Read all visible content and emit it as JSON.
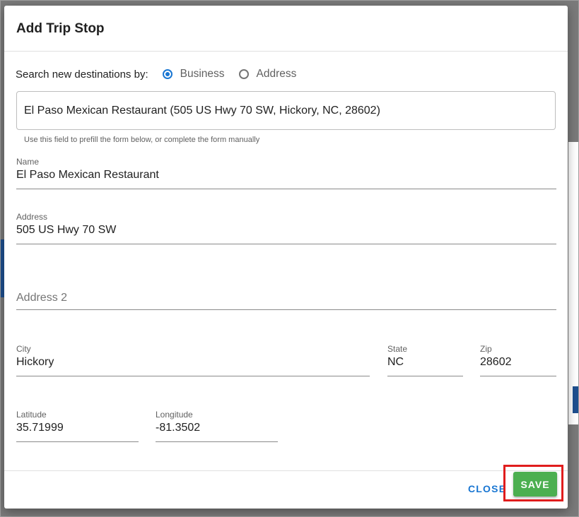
{
  "dialog": {
    "title": "Add Trip Stop",
    "search": {
      "label": "Search new destinations by:",
      "options": [
        {
          "label": "Business",
          "selected": true
        },
        {
          "label": "Address",
          "selected": false
        }
      ],
      "value": "El Paso Mexican Restaurant  (505 US Hwy 70 SW, Hickory, NC, 28602)",
      "hint": "Use this field to prefill the form below, or complete the form manually"
    },
    "fields": {
      "name": {
        "label": "Name",
        "value": "El Paso Mexican Restaurant"
      },
      "address": {
        "label": "Address",
        "value": "505 US Hwy 70 SW"
      },
      "address2": {
        "label": "Address 2",
        "value": ""
      },
      "city": {
        "label": "City",
        "value": "Hickory"
      },
      "state": {
        "label": "State",
        "value": "NC"
      },
      "zip": {
        "label": "Zip",
        "value": "28602"
      },
      "latitude": {
        "label": "Latitude",
        "value": "35.71999"
      },
      "longitude": {
        "label": "Longitude",
        "value": "-81.3502"
      }
    },
    "actions": {
      "close_label": "CLOSE",
      "save_label": "SAVE"
    }
  },
  "colors": {
    "accent": "#1976d2",
    "save": "#4caf50",
    "highlight": "#e01d1d"
  }
}
